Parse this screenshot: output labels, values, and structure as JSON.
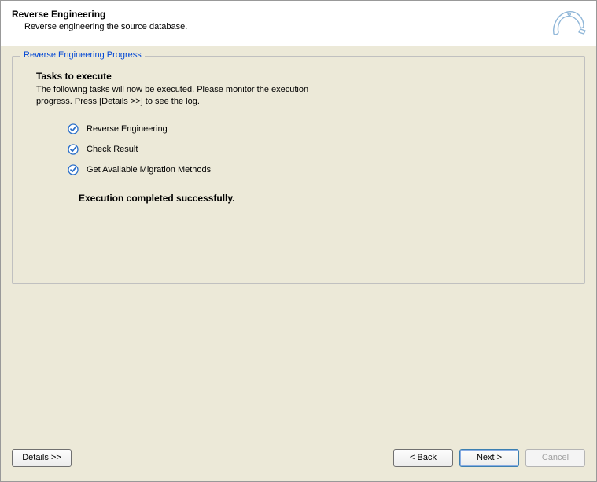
{
  "header": {
    "title": "Reverse Engineering",
    "subtitle": "Reverse engineering the source database."
  },
  "groupbox": {
    "legend": "Reverse Engineering Progress",
    "tasks_heading": "Tasks to execute",
    "tasks_desc": "The following tasks will now be executed. Please monitor the execution progress. Press [Details >>] to see the log.",
    "tasks": [
      {
        "label": "Reverse Engineering",
        "done": true
      },
      {
        "label": "Check Result",
        "done": true
      },
      {
        "label": "Get Available Migration Methods",
        "done": true
      }
    ],
    "status": "Execution completed successfully."
  },
  "buttons": {
    "details": "Details >>",
    "back": "< Back",
    "next": "Next >",
    "cancel": "Cancel"
  },
  "icons": {
    "checkmark": "checkmark-icon",
    "dolphin": "mysql-dolphin-icon"
  }
}
